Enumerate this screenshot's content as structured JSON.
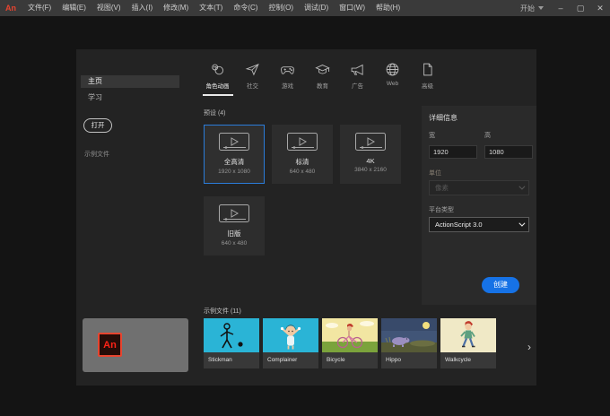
{
  "menubar": {
    "logo": "An",
    "menus": [
      "文件(F)",
      "编辑(E)",
      "视图(V)",
      "插入(I)",
      "修改(M)",
      "文本(T)",
      "命令(C)",
      "控制(O)",
      "调试(D)",
      "窗口(W)",
      "帮助(H)"
    ],
    "workspace": "开始",
    "minimize": "–",
    "maximize": "▢",
    "close": "✕"
  },
  "sidebar": {
    "items": [
      {
        "label": "主页"
      },
      {
        "label": "学习"
      }
    ],
    "open_button": "打开",
    "footer_link": "示例文件"
  },
  "tabs": [
    {
      "label": "角色动画",
      "icon": "character-animation-icon",
      "active": true
    },
    {
      "label": "社交",
      "icon": "paper-plane-icon",
      "active": false
    },
    {
      "label": "游戏",
      "icon": "gamepad-icon",
      "active": false
    },
    {
      "label": "教育",
      "icon": "graduation-cap-icon",
      "active": false
    },
    {
      "label": "广告",
      "icon": "megaphone-icon",
      "active": false
    },
    {
      "label": "Web",
      "icon": "globe-icon",
      "active": false
    },
    {
      "label": "高级",
      "icon": "document-icon",
      "active": false
    }
  ],
  "presets": {
    "header": "预设 (4)",
    "cards": [
      {
        "title": "全高清",
        "resolution": "1920 x 1080",
        "selected": true
      },
      {
        "title": "标清",
        "resolution": "640 x 480",
        "selected": false
      },
      {
        "title": "4K",
        "resolution": "3840 x 2160",
        "selected": false
      },
      {
        "title": "旧版",
        "resolution": "640 x 480",
        "selected": false
      }
    ]
  },
  "details": {
    "header": "详细信息",
    "width_label": "宽",
    "width_value": "1920",
    "height_label": "高",
    "height_value": "1080",
    "units_label": "单位",
    "units_value": "像素",
    "platform_label": "平台类型",
    "platform_value": "ActionScript 3.0",
    "create_button": "创建"
  },
  "samples": {
    "header": "示例文件 (11)",
    "items": [
      {
        "name": "Stickman",
        "bg": "#2ab4d6"
      },
      {
        "name": "Complainer",
        "bg": "#2ab4d6"
      },
      {
        "name": "Bicycle",
        "bg": "#f2e6a2"
      },
      {
        "name": "Hippo",
        "bg": "#415577"
      },
      {
        "name": "Walkcycle",
        "bg": "#f0e9c6"
      }
    ],
    "next_arrow": "›"
  },
  "colors": {
    "accent_blue": "#1672e6",
    "selection_border": "#2b7cd9",
    "logo_red": "#e8442f",
    "menubar_bg": "#3a3a3a",
    "panel_bg": "#232323"
  }
}
